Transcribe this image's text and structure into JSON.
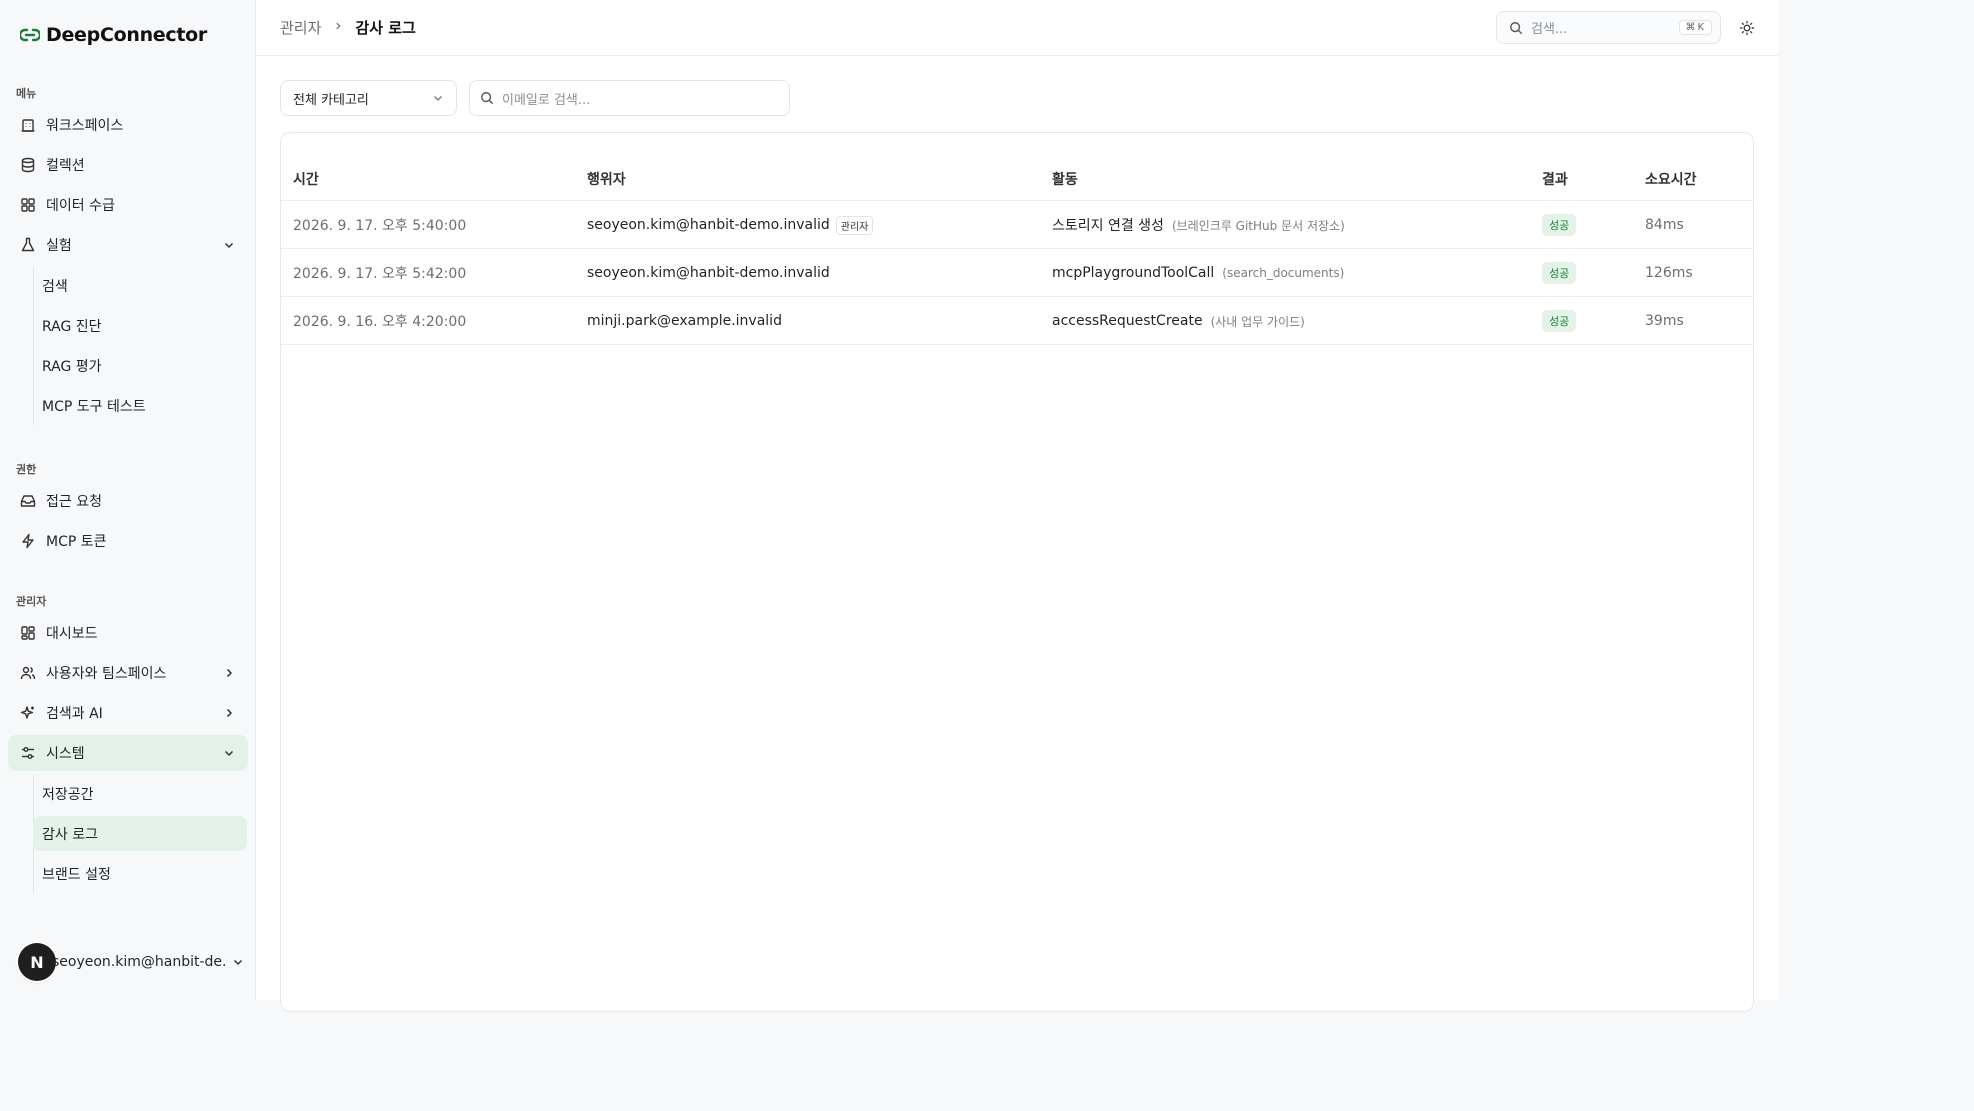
{
  "app": {
    "brand": "DeepConnector"
  },
  "sidebar": {
    "menu_title": "메뉴",
    "menu": [
      {
        "label": "워크스페이스",
        "icon": "building-icon"
      },
      {
        "label": "컬렉션",
        "icon": "database-icon"
      },
      {
        "label": "데이터 수급",
        "icon": "grid-icon"
      },
      {
        "label": "실험",
        "icon": "flask-icon"
      }
    ],
    "experiment_sub": [
      "검색",
      "RAG 진단",
      "RAG 평가",
      "MCP 도구 테스트"
    ],
    "permission_title": "권한",
    "permission": [
      {
        "label": "접근 요청",
        "icon": "inbox-icon"
      },
      {
        "label": "MCP 토큰",
        "icon": "bolt-icon"
      }
    ],
    "admin_title": "관리자",
    "admin": [
      {
        "label": "대시보드",
        "icon": "dashboard-icon"
      },
      {
        "label": "사용자와 팀스페이스",
        "icon": "users-icon"
      },
      {
        "label": "검색과 AI",
        "icon": "sparkle-icon"
      },
      {
        "label": "시스템",
        "icon": "settings-icon"
      }
    ],
    "system_sub": [
      "저장공간",
      "감사 로그",
      "브랜드 설정"
    ],
    "user": {
      "avatar_letter": "N",
      "email": "seoyeon.kim@hanbit-de..."
    }
  },
  "header": {
    "breadcrumb_parent": "관리자",
    "breadcrumb_current": "감사 로그",
    "search_placeholder": "검색...",
    "search_shortcut": "⌘K"
  },
  "filters": {
    "category_selected": "전체 카테고리",
    "email_placeholder": "이메일로 검색..."
  },
  "table": {
    "columns": [
      "시간",
      "행위자",
      "활동",
      "결과",
      "소요시간"
    ],
    "rows": [
      {
        "time": "2026. 9. 17. 오후 5:40:00",
        "actor": "seoyeon.kim@hanbit-demo.invalid",
        "actor_tag": "관리자",
        "activity": "스토리지 연결 생성",
        "detail": "(브레인크루 GitHub 문서 저장소)",
        "result": "성공",
        "duration": "84ms"
      },
      {
        "time": "2026. 9. 17. 오후 5:42:00",
        "actor": "seoyeon.kim@hanbit-demo.invalid",
        "actor_tag": "",
        "activity": "mcpPlaygroundToolCall",
        "detail": "(search_documents)",
        "result": "성공",
        "duration": "126ms"
      },
      {
        "time": "2026. 9. 16. 오후 4:20:00",
        "actor": "minji.park@example.invalid",
        "actor_tag": "",
        "activity": "accessRequestCreate",
        "detail": "(사내 업무 가이드)",
        "result": "성공",
        "duration": "39ms"
      }
    ]
  },
  "colors": {
    "accent": "#1e7b3a",
    "active_bg": "#e4f1e8"
  }
}
